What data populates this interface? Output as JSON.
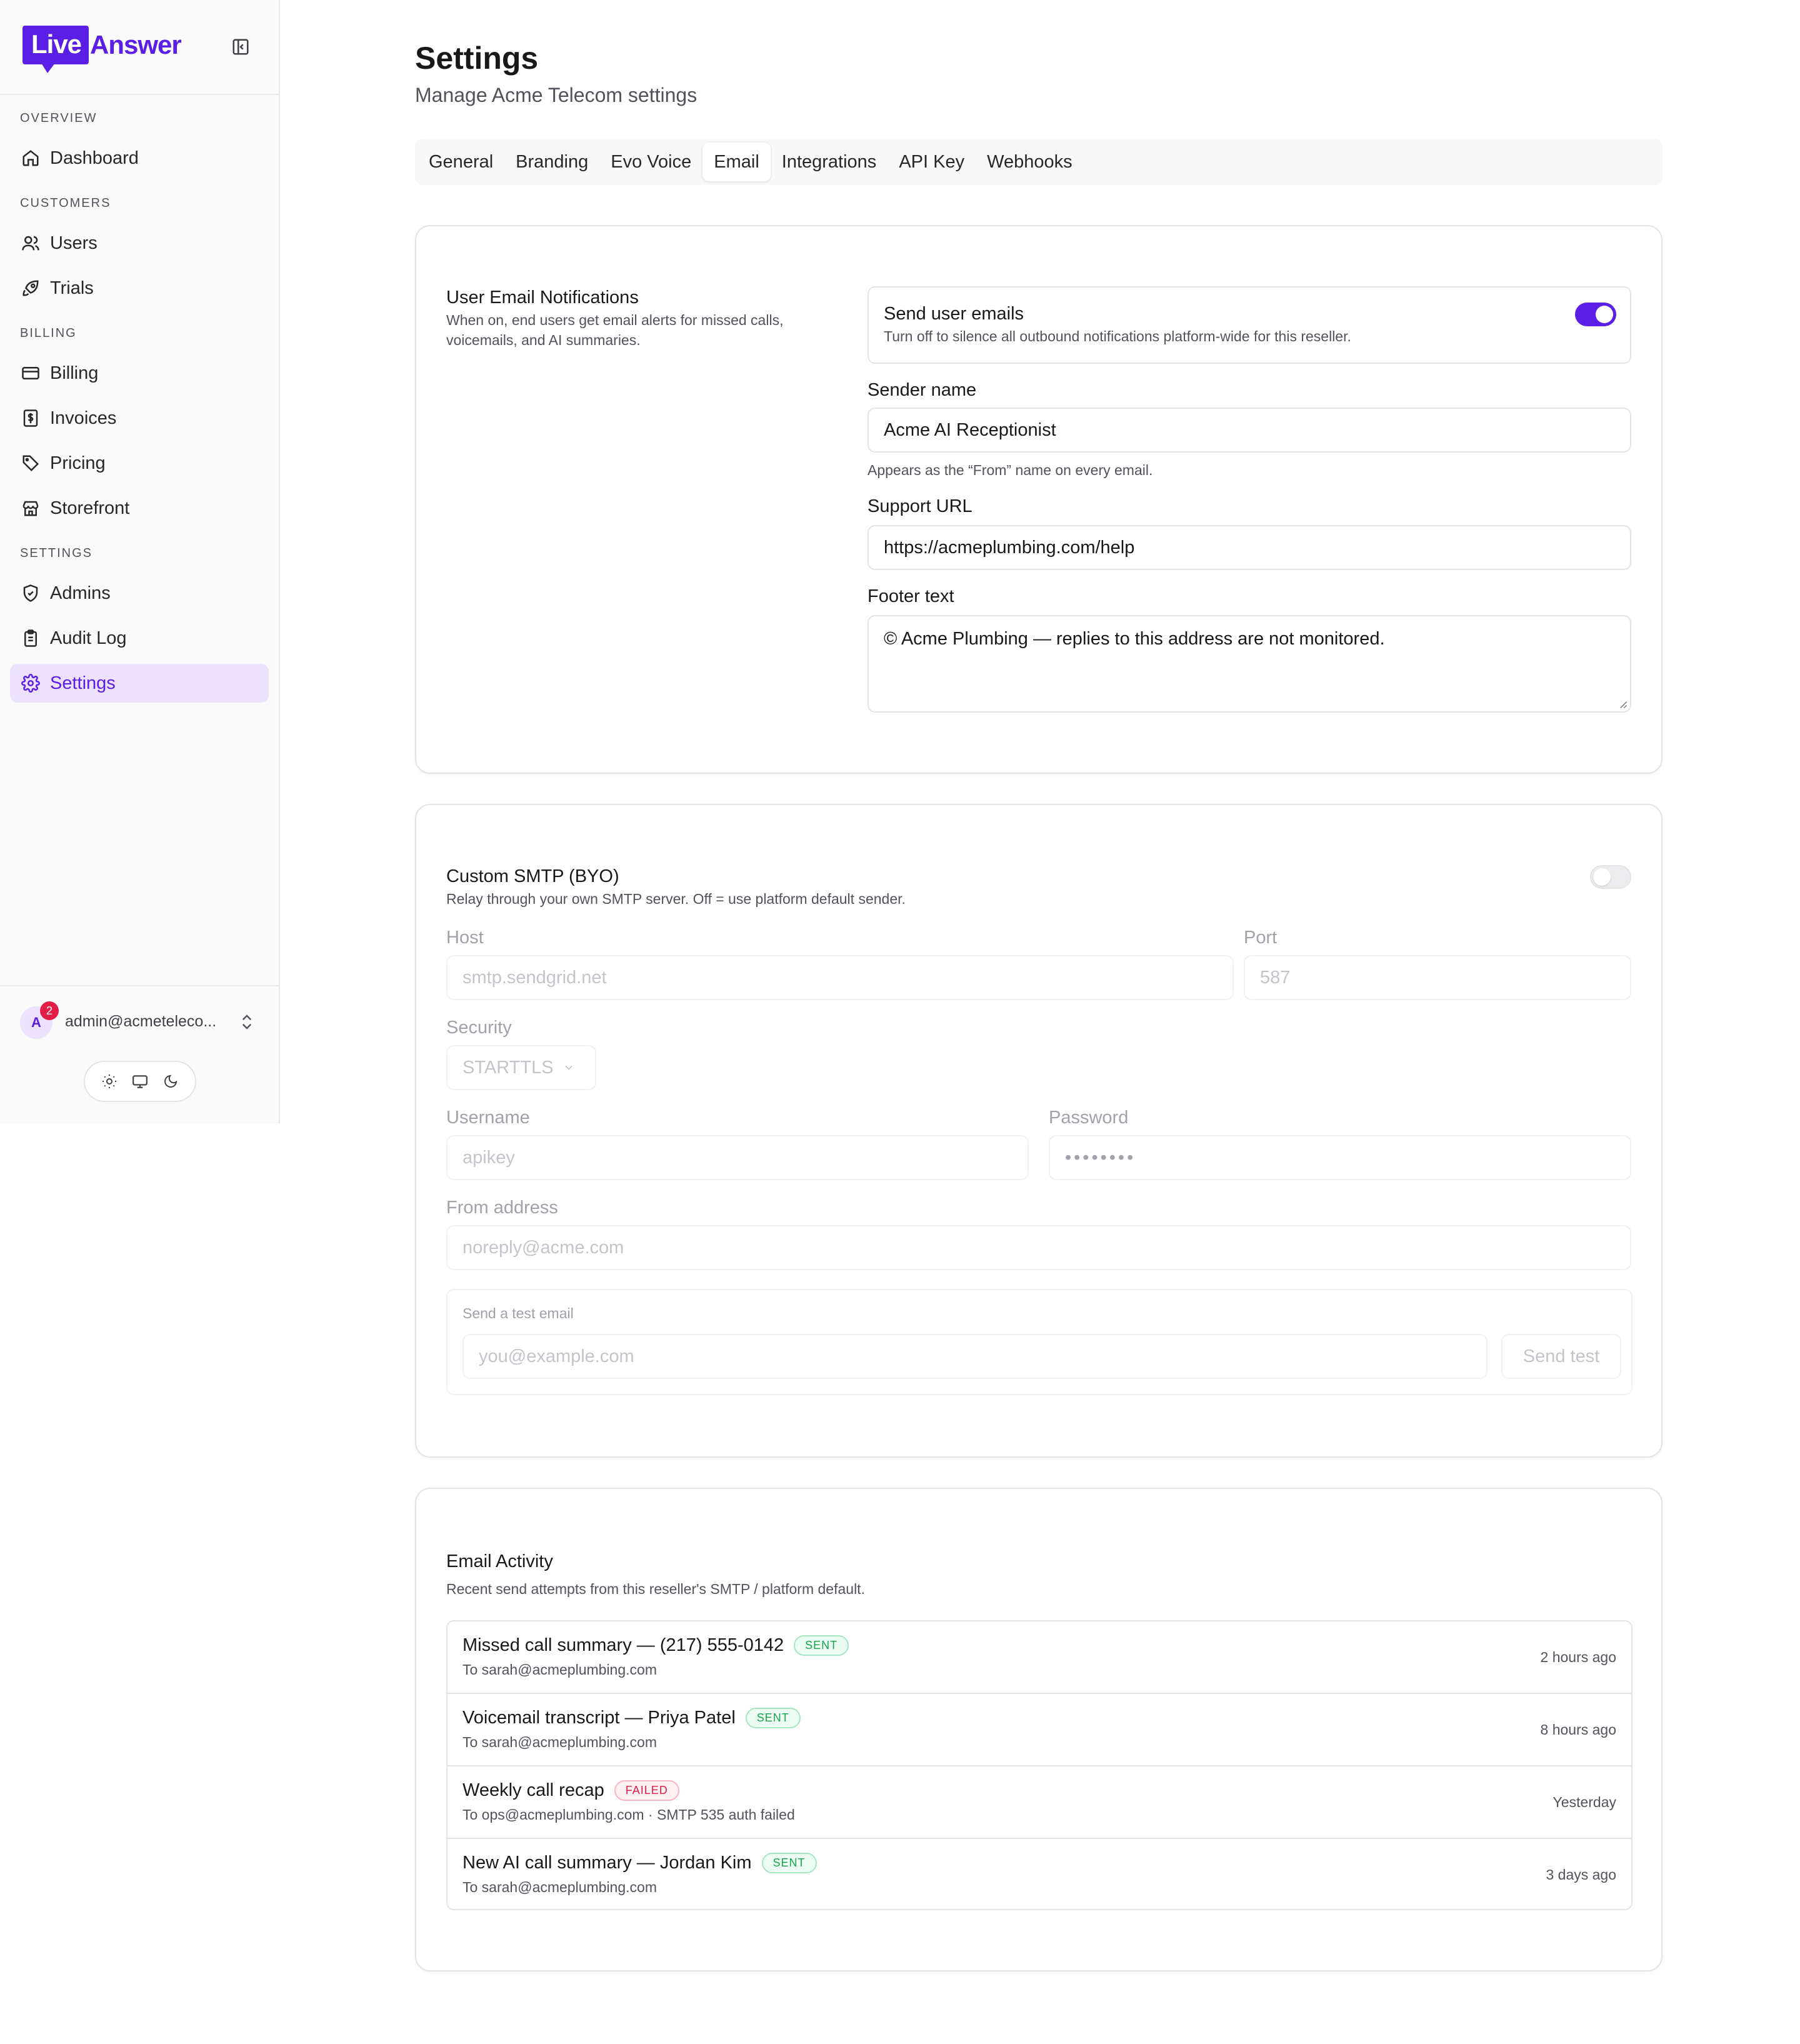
{
  "brand": {
    "logo_part1": "Live",
    "logo_part2": "Answer",
    "accent": "#5b1ee6"
  },
  "sidebar": {
    "sections": [
      {
        "title": "OVERVIEW",
        "items": [
          {
            "label": "Dashboard",
            "icon": "home-icon"
          }
        ]
      },
      {
        "title": "CUSTOMERS",
        "items": [
          {
            "label": "Users",
            "icon": "users-icon"
          },
          {
            "label": "Trials",
            "icon": "rocket-icon"
          }
        ]
      },
      {
        "title": "BILLING",
        "items": [
          {
            "label": "Billing",
            "icon": "credit-card-icon"
          },
          {
            "label": "Invoices",
            "icon": "receipt-icon"
          },
          {
            "label": "Pricing",
            "icon": "tag-icon"
          },
          {
            "label": "Storefront",
            "icon": "store-icon"
          }
        ]
      },
      {
        "title": "SETTINGS",
        "items": [
          {
            "label": "Admins",
            "icon": "shield-icon"
          },
          {
            "label": "Audit Log",
            "icon": "clipboard-icon"
          },
          {
            "label": "Settings",
            "icon": "gear-icon",
            "active": true
          }
        ]
      }
    ],
    "user": {
      "initial": "A",
      "notification_count": "2",
      "email": "admin@acmeteleco..."
    }
  },
  "header": {
    "title": "Settings",
    "subtitle": "Manage Acme Telecom settings"
  },
  "tabs": [
    {
      "label": "General"
    },
    {
      "label": "Branding"
    },
    {
      "label": "Evo Voice"
    },
    {
      "label": "Email",
      "active": true
    },
    {
      "label": "Integrations"
    },
    {
      "label": "API Key"
    },
    {
      "label": "Webhooks"
    }
  ],
  "notifications": {
    "title": "User Email Notifications",
    "description": "When on, end users get email alerts for missed calls, voicemails, and AI summaries.",
    "send_toggle": {
      "label": "Send user emails",
      "description": "Turn off to silence all outbound notifications platform-wide for this reseller.",
      "on": true
    },
    "sender_name": {
      "label": "Sender name",
      "value": "Acme AI Receptionist",
      "help": "Appears as the “From” name on every email."
    },
    "support_url": {
      "label": "Support URL",
      "value": "https://acmeplumbing.com/help"
    },
    "footer_text": {
      "label": "Footer text",
      "value": "© Acme Plumbing — replies to this address are not monitored."
    }
  },
  "smtp": {
    "title": "Custom SMTP (BYO)",
    "description": "Relay through your own SMTP server. Off = use platform default sender.",
    "enabled": false,
    "host": {
      "label": "Host",
      "placeholder": "smtp.sendgrid.net"
    },
    "port": {
      "label": "Port",
      "placeholder": "587"
    },
    "security": {
      "label": "Security",
      "value": "STARTTLS"
    },
    "username": {
      "label": "Username",
      "placeholder": "apikey"
    },
    "password": {
      "label": "Password",
      "value": "••••••••"
    },
    "from_address": {
      "label": "From address",
      "placeholder": "noreply@acme.com"
    },
    "test": {
      "label": "Send a test email",
      "placeholder": "you@example.com",
      "button": "Send test"
    }
  },
  "activity": {
    "title": "Email Activity",
    "description": "Recent send attempts from this reseller's SMTP / platform default.",
    "items": [
      {
        "subject": "Missed call summary — (217) 555-0142",
        "status": "SENT",
        "to": "To sarah@acmeplumbing.com",
        "time": "2 hours ago"
      },
      {
        "subject": "Voicemail transcript — Priya Patel",
        "status": "SENT",
        "to": "To sarah@acmeplumbing.com",
        "time": "8 hours ago"
      },
      {
        "subject": "Weekly call recap",
        "status": "FAILED",
        "to": "To ops@acmeplumbing.com · SMTP 535 auth failed",
        "time": "Yesterday"
      },
      {
        "subject": "New AI call summary — Jordan Kim",
        "status": "SENT",
        "to": "To sarah@acmeplumbing.com",
        "time": "3 days ago"
      }
    ]
  }
}
